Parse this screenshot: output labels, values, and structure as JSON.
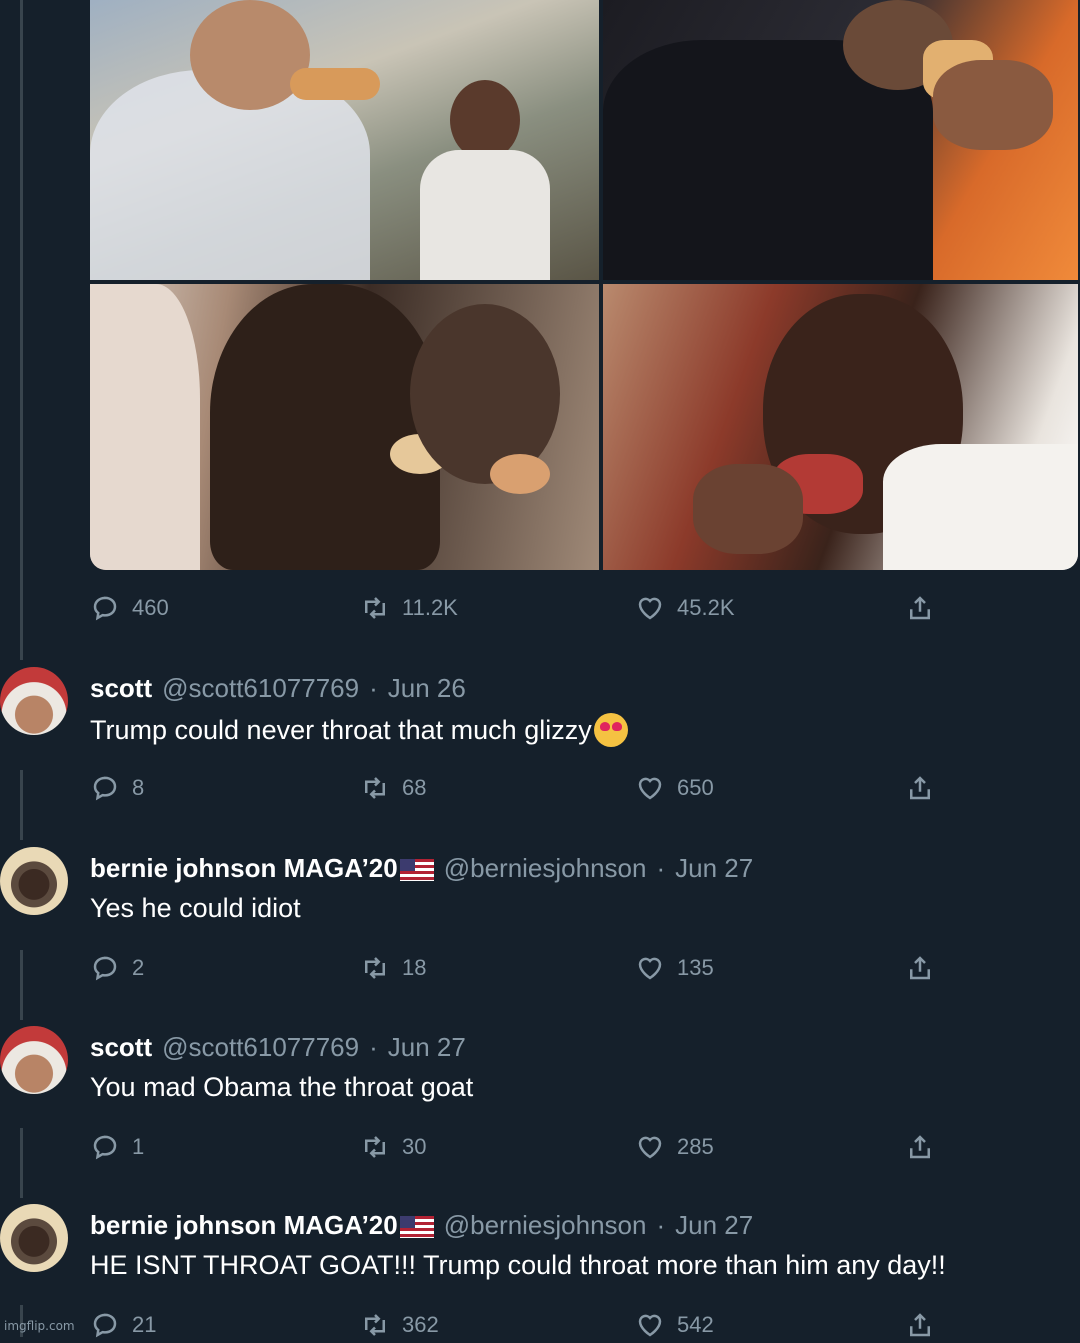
{
  "main_tweet": {
    "stats": {
      "replies": "460",
      "retweets": "11.2K",
      "likes": "45.2K"
    }
  },
  "replies": [
    {
      "name": "scott",
      "handle": "@scott61077769",
      "date": "Jun 26",
      "text": "Trump could never throat that much glizzy",
      "emoji": "heart-eyes-emoji",
      "flag": false,
      "stats": {
        "replies": "8",
        "retweets": "68",
        "likes": "650"
      }
    },
    {
      "name": "bernie johnson MAGA’20",
      "handle": "@berniesjohnson",
      "date": "Jun 27",
      "text": "Yes he could idiot",
      "flag": true,
      "stats": {
        "replies": "2",
        "retweets": "18",
        "likes": "135"
      }
    },
    {
      "name": "scott",
      "handle": "@scott61077769",
      "date": "Jun 27",
      "text": "You mad Obama the throat goat",
      "flag": false,
      "stats": {
        "replies": "1",
        "retweets": "30",
        "likes": "285"
      }
    },
    {
      "name": "bernie johnson MAGA’20",
      "handle": "@berniesjohnson",
      "date": "Jun 27",
      "text": "HE ISNT THROAT GOAT!!! Trump could throat more than him any day!!",
      "flag": true,
      "stats": {
        "replies": "21",
        "retweets": "362",
        "likes": "542"
      }
    }
  ],
  "separator": "·",
  "watermark": "imgflip.com",
  "colors": {
    "background": "#15202b",
    "muted": "#8899a6",
    "text": "#ffffff"
  }
}
